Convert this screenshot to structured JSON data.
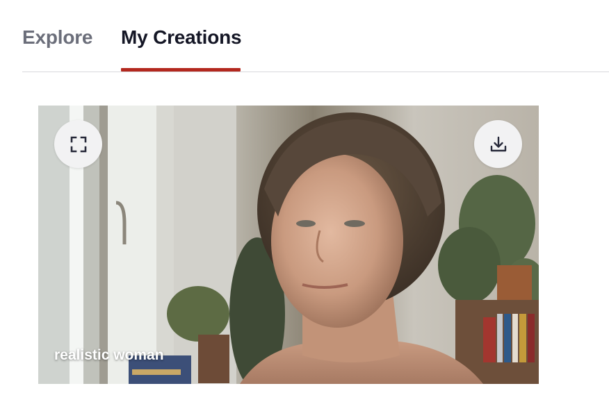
{
  "tabs": [
    {
      "label": "Explore",
      "active": false
    },
    {
      "label": "My Creations",
      "active": true
    }
  ],
  "accent_color": "#b3281e",
  "creation": {
    "caption": "realistic woman",
    "fullscreen_icon": "fullscreen-icon",
    "download_icon": "download-icon"
  }
}
